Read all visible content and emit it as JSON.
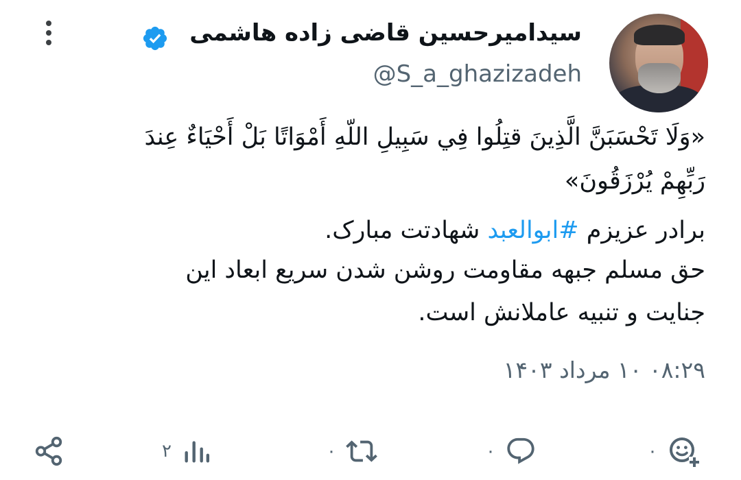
{
  "author": {
    "display_name": "سیدامیرحسین قاضی زاده هاشمی",
    "handle": "@S_a_ghazizadeh",
    "verified_color": "#1d9bf0"
  },
  "tweet": {
    "line1": "«وَلَا تَحْسَبَنَّ الَّذِینَ قتِلُوا فِي سَبِيلِ اللّهِ أَمْوَاتًا بَلْ أَحْيَاءٌ عِندَ",
    "line2": "رَبِّهِمْ يُرْزَقُونَ»",
    "line3_before": "برادر عزیزم ",
    "hashtag": "#ابوالعبد",
    "line3_after": " شهادتت مبارک.",
    "line4": "حق مسلم جبهه مقاومت روشن شدن سریع ابعاد این",
    "line5": "جنایت و تنبیه عاملانش است."
  },
  "timestamp": "۰۸:۲۹ ۱۰ مرداد ۱۴۰۳",
  "actions": {
    "reply_count": "۰",
    "retweet_count": "۰",
    "like_count": "۰",
    "views_count": "۲"
  },
  "icons": [
    "more-vertical-icon",
    "verified-badge-icon",
    "share-icon",
    "views-icon",
    "retweet-icon",
    "reply-icon",
    "add-reaction-icon"
  ],
  "colors": {
    "accent": "#1d9bf0",
    "secondary_text": "#536471",
    "icon": "#536471"
  }
}
